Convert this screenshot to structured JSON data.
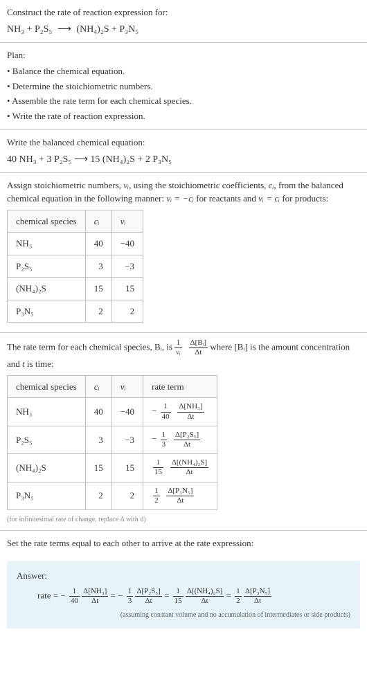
{
  "header": {
    "title": "Construct the rate of reaction expression for:",
    "equation_lhs": "NH₃ + P₂S₅",
    "equation_arrow": "⟶",
    "equation_rhs": "(NH₄)₂S + P₃N₅"
  },
  "plan": {
    "title": "Plan:",
    "items": [
      "• Balance the chemical equation.",
      "• Determine the stoichiometric numbers.",
      "• Assemble the rate term for each chemical species.",
      "• Write the rate of reaction expression."
    ]
  },
  "balanced": {
    "title": "Write the balanced chemical equation:",
    "equation": "40 NH₃ + 3 P₂S₅  ⟶  15 (NH₄)₂S + 2 P₃N₅"
  },
  "stoich": {
    "intro_a": "Assign stoichiometric numbers, ",
    "nu_i": "νᵢ",
    "intro_b": ", using the stoichiometric coefficients, ",
    "c_i": "cᵢ",
    "intro_c": ", from the balanced chemical equation in the following manner: ",
    "rel1": "νᵢ = −cᵢ",
    "intro_d": " for reactants and ",
    "rel2": "νᵢ = cᵢ",
    "intro_e": " for products:",
    "headers": [
      "chemical species",
      "cᵢ",
      "νᵢ"
    ],
    "rows": [
      {
        "species": "NH₃",
        "c": "40",
        "nu": "−40"
      },
      {
        "species": "P₂S₅",
        "c": "3",
        "nu": "−3"
      },
      {
        "species": "(NH₄)₂S",
        "c": "15",
        "nu": "15"
      },
      {
        "species": "P₃N₅",
        "c": "2",
        "nu": "2"
      }
    ]
  },
  "rate_term": {
    "intro_a": "The rate term for each chemical species, Bᵢ, is ",
    "frac1_num": "1",
    "frac1_den": "νᵢ",
    "frac2_num": "Δ[Bᵢ]",
    "frac2_den": "Δt",
    "intro_b": " where [Bᵢ] is the amount concentration and ",
    "t": "t",
    "intro_c": " is time:",
    "headers": [
      "chemical species",
      "cᵢ",
      "νᵢ",
      "rate term"
    ],
    "rows": [
      {
        "species": "NH₃",
        "c": "40",
        "nu": "−40",
        "sign": "−",
        "a_num": "1",
        "a_den": "40",
        "b_num": "Δ[NH₃]",
        "b_den": "Δt"
      },
      {
        "species": "P₂S₅",
        "c": "3",
        "nu": "−3",
        "sign": "−",
        "a_num": "1",
        "a_den": "3",
        "b_num": "Δ[P₂S₅]",
        "b_den": "Δt"
      },
      {
        "species": "(NH₄)₂S",
        "c": "15",
        "nu": "15",
        "sign": "",
        "a_num": "1",
        "a_den": "15",
        "b_num": "Δ[(NH₄)₂S]",
        "b_den": "Δt"
      },
      {
        "species": "P₃N₅",
        "c": "2",
        "nu": "2",
        "sign": "",
        "a_num": "1",
        "a_den": "2",
        "b_num": "Δ[P₃N₅]",
        "b_den": "Δt"
      }
    ],
    "note": "(for infinitesimal rate of change, replace Δ with d)"
  },
  "final": {
    "title": "Set the rate terms equal to each other to arrive at the rate expression:"
  },
  "answer": {
    "label": "Answer:",
    "prefix": "rate = ",
    "terms": [
      {
        "sign": "−",
        "a_num": "1",
        "a_den": "40",
        "b_num": "Δ[NH₃]",
        "b_den": "Δt"
      },
      {
        "sign": "−",
        "a_num": "1",
        "a_den": "3",
        "b_num": "Δ[P₂S₅]",
        "b_den": "Δt"
      },
      {
        "sign": "",
        "a_num": "1",
        "a_den": "15",
        "b_num": "Δ[(NH₄)₂S]",
        "b_den": "Δt"
      },
      {
        "sign": "",
        "a_num": "1",
        "a_den": "2",
        "b_num": "Δ[P₃N₅]",
        "b_den": "Δt"
      }
    ],
    "eq": " = ",
    "note": "(assuming constant volume and no accumulation of intermediates or side products)"
  }
}
